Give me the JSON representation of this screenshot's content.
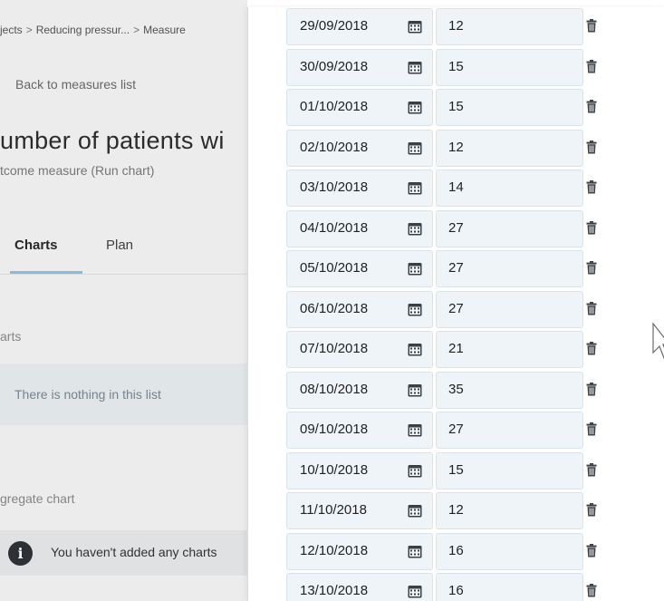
{
  "breadcrumb": {
    "items": [
      "jects",
      "Reducing pressur...",
      "Measure"
    ],
    "separator": ">"
  },
  "back_link": "Back to measures list",
  "page_title": "umber of patients wi",
  "page_subtitle": "tcome measure (Run chart)",
  "tabs": [
    {
      "label": "Charts",
      "active": true
    },
    {
      "label": "Plan",
      "active": false
    }
  ],
  "sections": {
    "charts_label": "arts",
    "empty_list_text": "There is nothing in this list",
    "aggregate_label": "gregate chart",
    "notice_text": "You haven't added any charts"
  },
  "icons": {
    "info": "info-icon",
    "calendar": "calendar-icon",
    "trash": "trash-icon",
    "cursor": "mouse-cursor-icon"
  },
  "colors": {
    "cell_bg": "#eef4f7",
    "cell_border": "#d9e3ea",
    "tab_underline": "#8ac4e6"
  },
  "rows": [
    {
      "date": "29/09/2018",
      "value": "12"
    },
    {
      "date": "30/09/2018",
      "value": "15"
    },
    {
      "date": "01/10/2018",
      "value": "15"
    },
    {
      "date": "02/10/2018",
      "value": "12"
    },
    {
      "date": "03/10/2018",
      "value": "14"
    },
    {
      "date": "04/10/2018",
      "value": "27"
    },
    {
      "date": "05/10/2018",
      "value": "27"
    },
    {
      "date": "06/10/2018",
      "value": "27"
    },
    {
      "date": "07/10/2018",
      "value": "21"
    },
    {
      "date": "08/10/2018",
      "value": "35"
    },
    {
      "date": "09/10/2018",
      "value": "27"
    },
    {
      "date": "10/10/2018",
      "value": "15"
    },
    {
      "date": "11/10/2018",
      "value": "12"
    },
    {
      "date": "12/10/2018",
      "value": "16"
    },
    {
      "date": "13/10/2018",
      "value": "16"
    }
  ]
}
